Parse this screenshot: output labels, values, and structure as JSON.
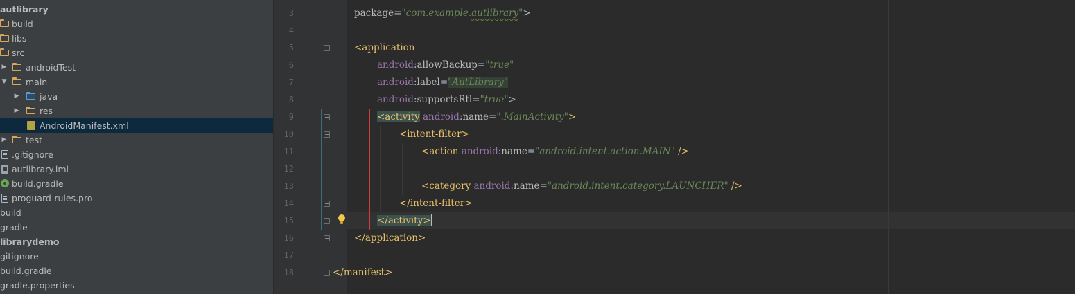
{
  "project_tree": {
    "items": [
      {
        "label": "autlibrary",
        "icon": "none",
        "expander": "",
        "bold": true
      },
      {
        "label": "build",
        "icon": "folder-icon",
        "expander": ""
      },
      {
        "label": "libs",
        "icon": "folder-icon",
        "expander": ""
      },
      {
        "label": "src",
        "icon": "folder-icon",
        "expander": ""
      },
      {
        "label": "androidTest",
        "icon": "folder-icon",
        "expander": "collapsed"
      },
      {
        "label": "main",
        "icon": "folder-icon",
        "expander": "expanded"
      },
      {
        "label": "java",
        "icon": "source-folder-icon",
        "expander": "collapsed"
      },
      {
        "label": "res",
        "icon": "resources-folder-icon",
        "expander": "collapsed"
      },
      {
        "label": "AndroidManifest.xml",
        "icon": "xml-manifest-icon",
        "expander": "",
        "selected": true
      },
      {
        "label": "test",
        "icon": "folder-icon",
        "expander": "collapsed"
      },
      {
        "label": ".gitignore",
        "icon": "file-icon",
        "expander": ""
      },
      {
        "label": "autlibrary.iml",
        "icon": "iml-file-icon",
        "expander": ""
      },
      {
        "label": "build.gradle",
        "icon": "gradle-icon",
        "expander": ""
      },
      {
        "label": "proguard-rules.pro",
        "icon": "file-icon",
        "expander": ""
      },
      {
        "label": "build",
        "icon": "none",
        "expander": ""
      },
      {
        "label": "gradle",
        "icon": "none",
        "expander": ""
      },
      {
        "label": "librarydemo",
        "icon": "none",
        "expander": "",
        "bold": true
      },
      {
        "label": "gitignore",
        "icon": "none",
        "expander": ""
      },
      {
        "label": "build.gradle",
        "icon": "none",
        "expander": ""
      },
      {
        "label": "gradle.properties",
        "icon": "none",
        "expander": ""
      }
    ]
  },
  "editor": {
    "line_numbers": [
      "3",
      "4",
      "5",
      "6",
      "7",
      "8",
      "9",
      "10",
      "11",
      "12",
      "13",
      "14",
      "15",
      "16",
      "17",
      "18"
    ],
    "lines": {
      "l3": {
        "attr": "package",
        "eq": "=",
        "val_pre": "\"com.example.",
        "val_squig": "autlibrary",
        "val_post": "\"",
        "close": ">"
      },
      "l5": {
        "tag": "<application"
      },
      "l6": {
        "ns": "android",
        "colon": ":",
        "attr": "allowBackup",
        "eq": "=",
        "val": "\"true\""
      },
      "l7": {
        "ns": "android",
        "colon": ":",
        "attr": "label",
        "eq": "=",
        "val": "\"AutLibrary\""
      },
      "l8": {
        "ns": "android",
        "colon": ":",
        "attr": "supportsRtl",
        "eq": "=",
        "val": "\"true\"",
        "close": ">"
      },
      "l9": {
        "tag": "<activity",
        "ns": "android",
        "colon": ":",
        "attr": "name",
        "eq": "=",
        "val": "\".MainActivity\"",
        "close": ">"
      },
      "l10": {
        "tag": "<intent-filter>"
      },
      "l11": {
        "tag": "<action",
        "ns": "android",
        "colon": ":",
        "attr": "name",
        "eq": "=",
        "val": "\"android.intent.action.MAIN\"",
        "close": " />"
      },
      "l13": {
        "tag": "<category",
        "ns": "android",
        "colon": ":",
        "attr": "name",
        "eq": "=",
        "val": "\"android.intent.category.LAUNCHER\"",
        "close": " />"
      },
      "l14": {
        "tag": "</intent-filter>"
      },
      "l15": {
        "tag": "</activity>"
      },
      "l16": {
        "tag": "</application>"
      },
      "l18": {
        "tag": "</manifest>"
      }
    }
  },
  "colors": {
    "tag": "#e8bf6a",
    "namespace": "#9876aa",
    "value": "#6a8759",
    "highlight_box": "#d23b3b",
    "selection": "#0d293e"
  }
}
